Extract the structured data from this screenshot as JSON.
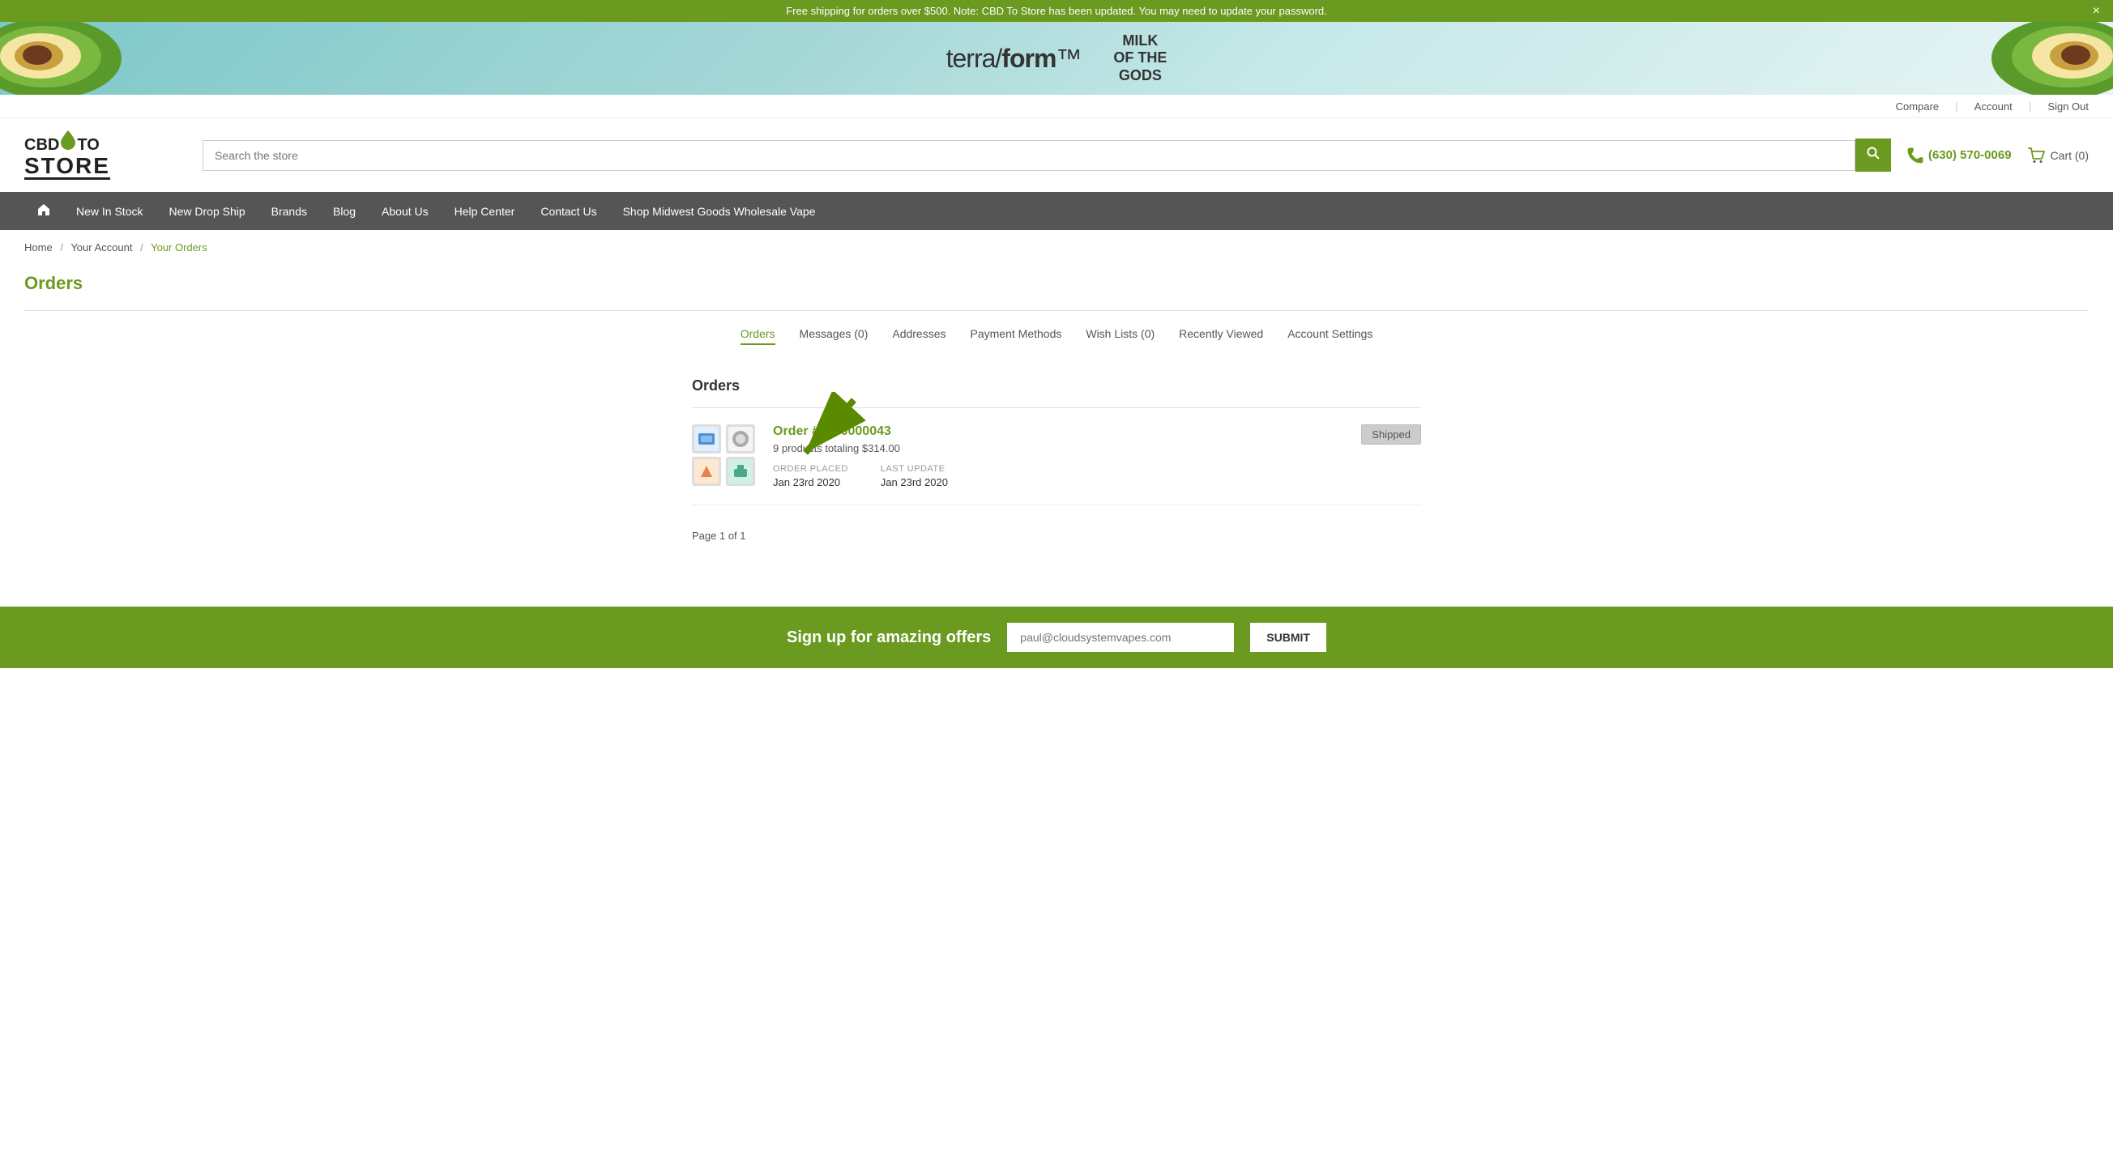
{
  "topBanner": {
    "message": "Free shipping for orders over $500. Note: CBD To Store has been updated. You may need to update your password.",
    "closeLabel": "×"
  },
  "utilityBar": {
    "compare": "Compare",
    "account": "Account",
    "signOut": "Sign Out"
  },
  "header": {
    "logoLine1": "CBD",
    "logoLine2": "TO",
    "logoLine3": "STORE",
    "searchPlaceholder": "Search the store",
    "phone": "(630) 570-0069",
    "cartLabel": "Cart (0)"
  },
  "nav": {
    "items": [
      {
        "label": "New In Stock",
        "id": "new-in-stock"
      },
      {
        "label": "New Drop Ship",
        "id": "new-drop-ship"
      },
      {
        "label": "Brands",
        "id": "brands"
      },
      {
        "label": "Blog",
        "id": "blog"
      },
      {
        "label": "About Us",
        "id": "about-us"
      },
      {
        "label": "Help Center",
        "id": "help-center"
      },
      {
        "label": "Contact Us",
        "id": "contact-us"
      },
      {
        "label": "Shop Midwest Goods Wholesale Vape",
        "id": "shop-midwest"
      }
    ]
  },
  "breadcrumb": {
    "home": "Home",
    "yourAccount": "Your Account",
    "current": "Your Orders"
  },
  "pageTitle": "Orders",
  "accountTabs": [
    {
      "label": "Orders",
      "active": true,
      "id": "tab-orders"
    },
    {
      "label": "Messages (0)",
      "active": false,
      "id": "tab-messages"
    },
    {
      "label": "Addresses",
      "active": false,
      "id": "tab-addresses"
    },
    {
      "label": "Payment Methods",
      "active": false,
      "id": "tab-payment"
    },
    {
      "label": "Wish Lists (0)",
      "active": false,
      "id": "tab-wishlists"
    },
    {
      "label": "Recently Viewed",
      "active": false,
      "id": "tab-recently-viewed"
    },
    {
      "label": "Account Settings",
      "active": false,
      "id": "tab-settings"
    }
  ],
  "ordersSection": {
    "heading": "Orders",
    "orders": [
      {
        "id": "order-1",
        "number": "Order #1000000043",
        "products": "9 products totaling $314.00",
        "orderPlacedLabel": "ORDER PLACED",
        "orderPlacedDate": "Jan 23rd 2020",
        "lastUpdateLabel": "LAST UPDATE",
        "lastUpdateDate": "Jan 23rd 2020",
        "status": "Shipped"
      }
    ],
    "pagination": "Page 1 of 1"
  },
  "footerSignup": {
    "title": "Sign up for amazing offers",
    "emailPlaceholder": "paul@cloudsystemvapes.com",
    "submitLabel": "SUBMIT"
  },
  "promo": {
    "terraform": "terra/form",
    "milkLine1": "MILK",
    "milkLine2": "OF THE",
    "milkLine3": "GODS"
  }
}
